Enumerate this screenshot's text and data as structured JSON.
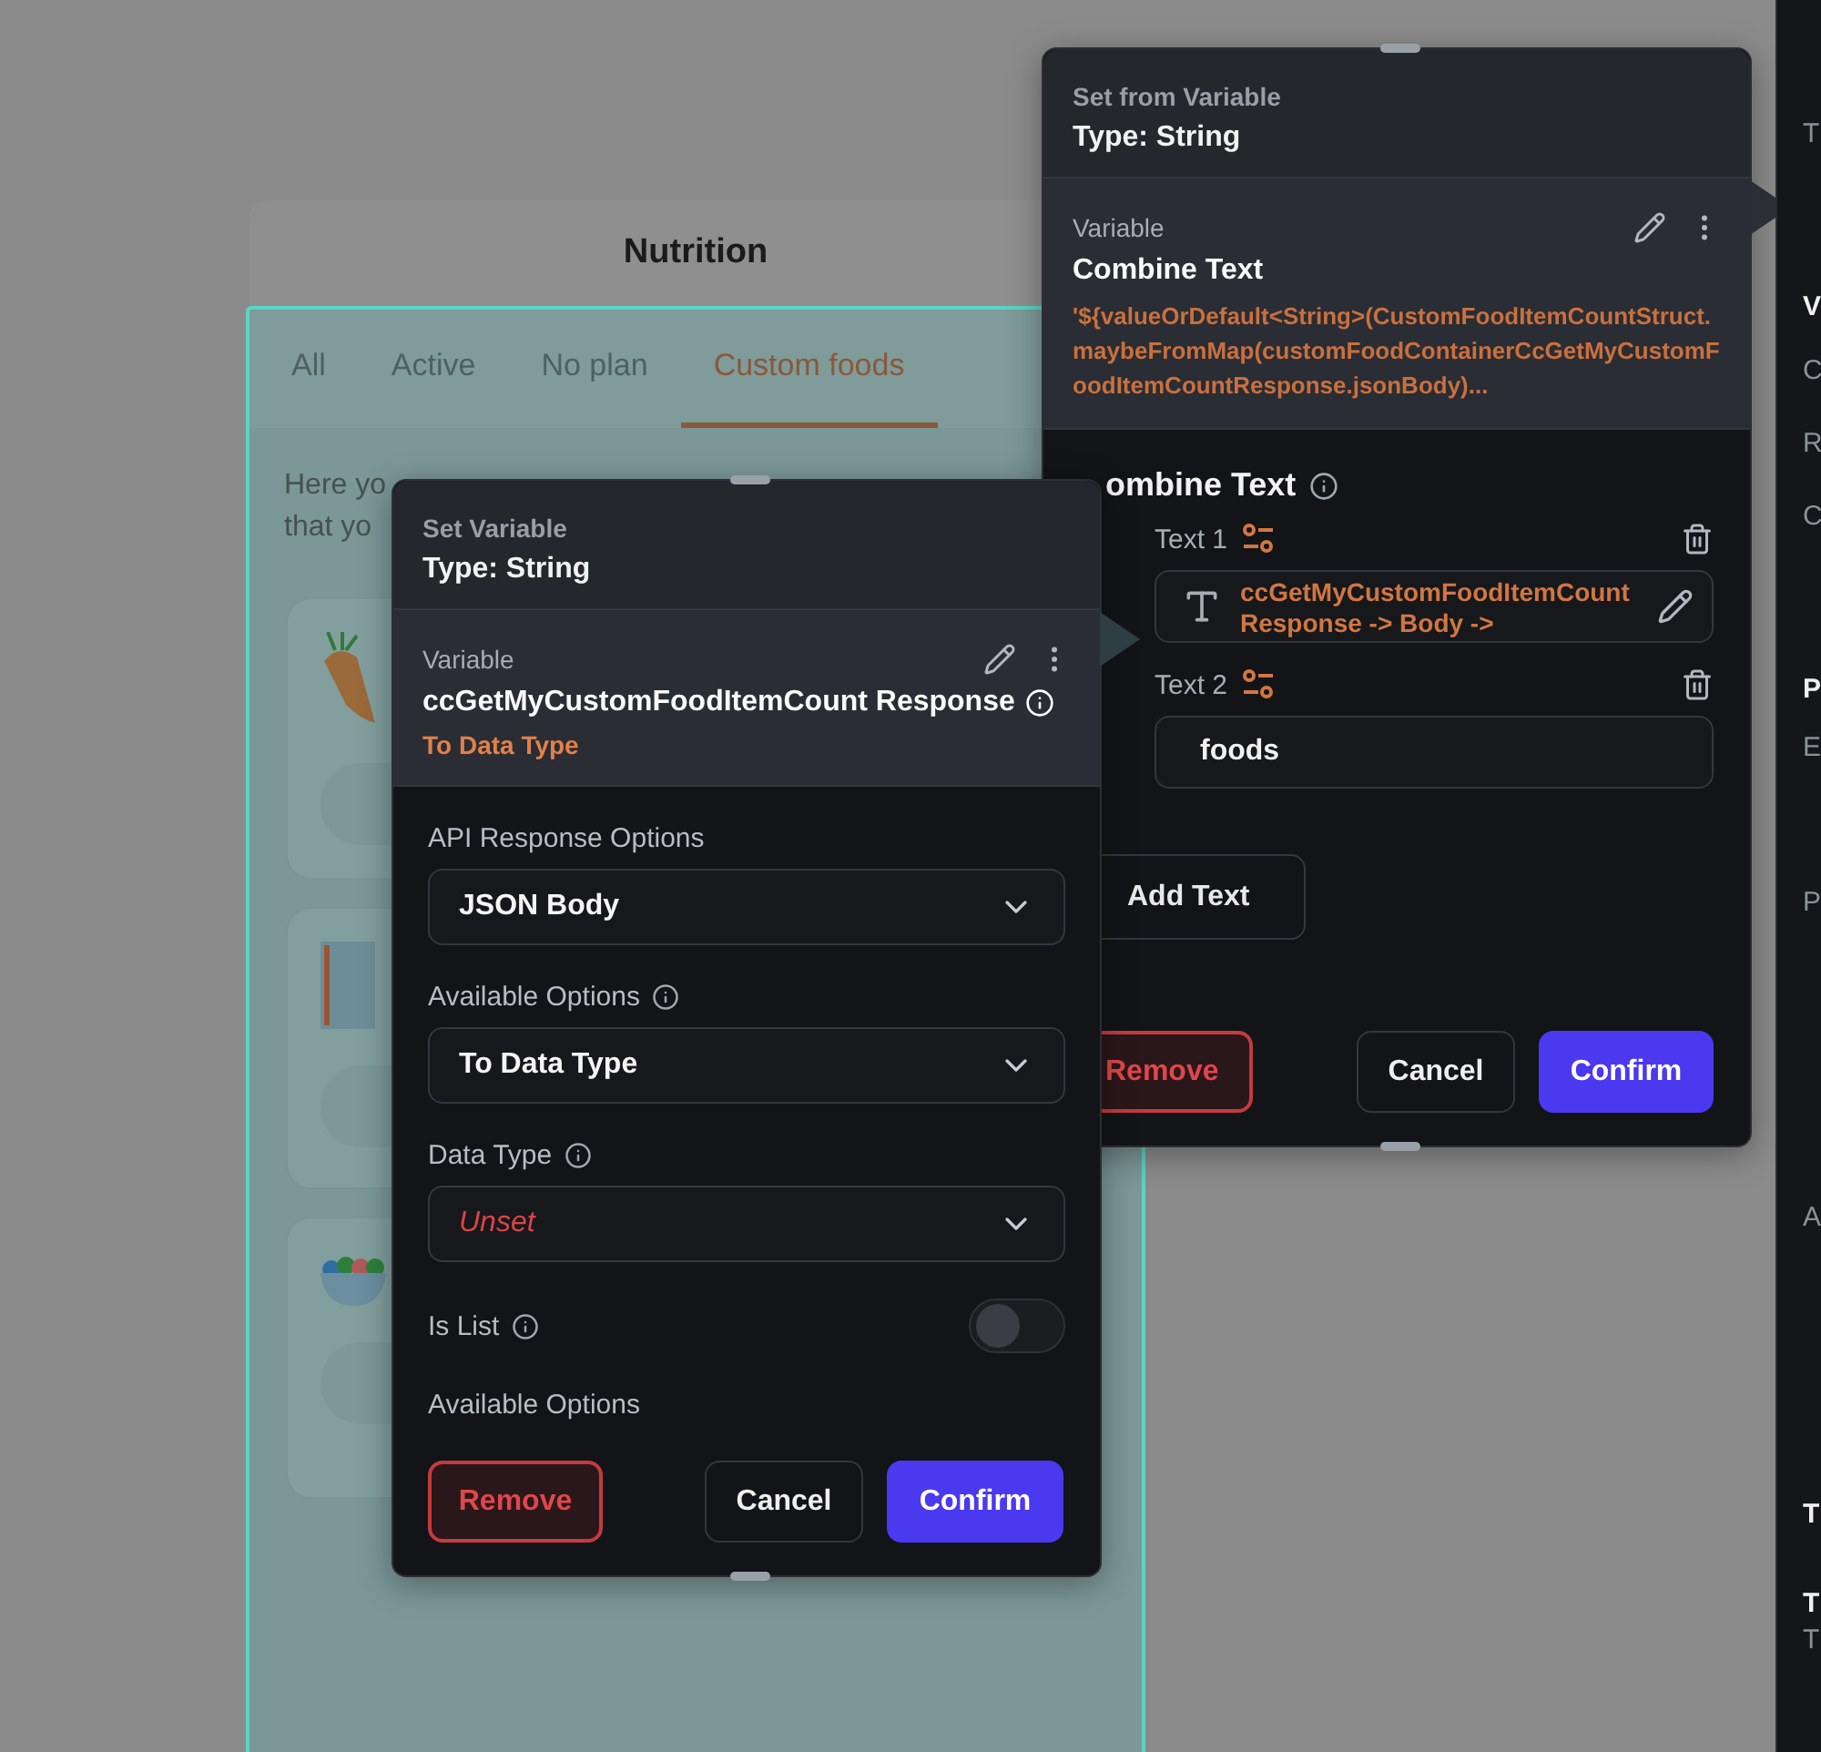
{
  "canvas_page": {
    "title": "Nutrition",
    "tabs": [
      {
        "label": "All",
        "selected": false
      },
      {
        "label": "Active",
        "selected": false
      },
      {
        "label": "No plan",
        "selected": false
      },
      {
        "label": "Custom foods",
        "selected": true
      }
    ],
    "intro_lines": [
      "Here yo",
      "that yo"
    ]
  },
  "set_from_variable_panel": {
    "heading": "Set from Variable",
    "type_label": "Type: String",
    "variable_label": "Variable",
    "variable_name": "Combine Text",
    "variable_value": "'${valueOrDefault<String>(CustomFoodItemCountStruct.maybeFromMap(customFoodContainerCcGetMyCustomFoodItemCountResponse.jsonBody)...",
    "section_title": "ombine Text",
    "texts": [
      {
        "label": "Text 1",
        "kind": "variable",
        "value": "ccGetMyCustomFoodItemCount Response -> Body ->"
      },
      {
        "label": "Text 2",
        "kind": "literal",
        "value": "foods"
      }
    ],
    "add_button": "Add Text",
    "remove": "Remove",
    "cancel": "Cancel",
    "confirm": "Confirm"
  },
  "set_variable_panel": {
    "heading": "Set Variable",
    "type_label": "Type: String",
    "variable_label": "Variable",
    "variable_name": "ccGetMyCustomFoodItemCount Response",
    "variable_sub": "To Data Type",
    "fields": [
      {
        "kind": "dropdown",
        "label": "API Response Options",
        "info": false,
        "value": "JSON Body",
        "unset": false
      },
      {
        "kind": "dropdown",
        "label": "Available Options",
        "info": true,
        "value": "To Data Type",
        "unset": false
      },
      {
        "kind": "dropdown",
        "label": "Data Type",
        "info": true,
        "value": "Unset",
        "unset": true
      },
      {
        "kind": "toggle",
        "label": "Is List",
        "info": true,
        "on": false
      },
      {
        "kind": "caption",
        "label": "Available Options"
      }
    ],
    "remove": "Remove",
    "cancel": "Cancel",
    "confirm": "Confirm"
  },
  "inspector_sidebar": {
    "items": [
      {
        "kind": "label",
        "text": "T"
      },
      {
        "kind": "heading",
        "text": "V"
      },
      {
        "kind": "label",
        "text": "C"
      },
      {
        "kind": "label",
        "text": "R"
      },
      {
        "kind": "label",
        "text": "C"
      },
      {
        "kind": "heading",
        "text": "P"
      },
      {
        "kind": "label",
        "text": "E"
      },
      {
        "kind": "label",
        "text": "P"
      },
      {
        "kind": "label",
        "text": "A"
      },
      {
        "kind": "heading",
        "text": "T"
      },
      {
        "kind": "heading",
        "text": "T"
      },
      {
        "kind": "label",
        "text": "T"
      }
    ]
  }
}
